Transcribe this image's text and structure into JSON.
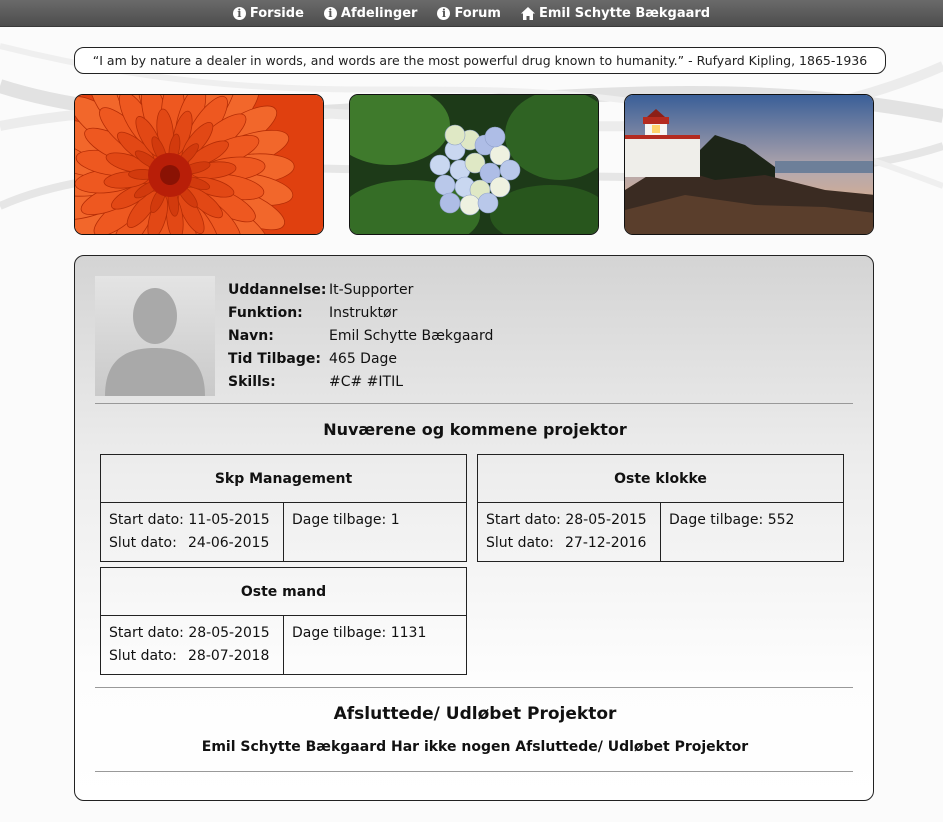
{
  "nav": {
    "items": [
      {
        "label": "Forside",
        "icon": "info-icon"
      },
      {
        "label": "Afdelinger",
        "icon": "info-icon"
      },
      {
        "label": "Forum",
        "icon": "info-icon"
      },
      {
        "label": "Emil Schytte Bækgaard",
        "icon": "home-icon"
      }
    ]
  },
  "quote": "“I am by nature a dealer in words, and words are the most powerful drug known to humanity.” - Rufyard Kipling, 1865-1936",
  "photos": [
    "flower-photo",
    "hydrangea-photo",
    "lighthouse-photo"
  ],
  "profile": {
    "rows": [
      {
        "label": "Uddannelse:",
        "value": "It-Supporter"
      },
      {
        "label": "Funktion:",
        "value": "Instruktør"
      },
      {
        "label": "Navn:",
        "value": "Emil Schytte Bækgaard"
      },
      {
        "label": "Tid Tilbage:",
        "value": "465 Dage"
      },
      {
        "label": "Skills:",
        "value": "#C# #ITIL"
      }
    ]
  },
  "current_projects": {
    "title": "Nuværene og kommene projektor",
    "start_label": "Start dato:",
    "end_label": "Slut dato:",
    "days_label": "Dage tilbage:",
    "items": [
      {
        "name": "Skp Management",
        "start": "11-05-2015",
        "end": "24-06-2015",
        "days": "1"
      },
      {
        "name": "Oste klokke",
        "start": "28-05-2015",
        "end": "27-12-2016",
        "days": "552"
      },
      {
        "name": "Oste mand",
        "start": "28-05-2015",
        "end": "28-07-2018",
        "days": "1131"
      }
    ]
  },
  "finished_projects": {
    "title": "Afsluttede/ Udløbet Projektor",
    "empty_message": "Emil Schytte Bækgaard Har ikke nogen Afsluttede/ Udløbet Projektor"
  }
}
